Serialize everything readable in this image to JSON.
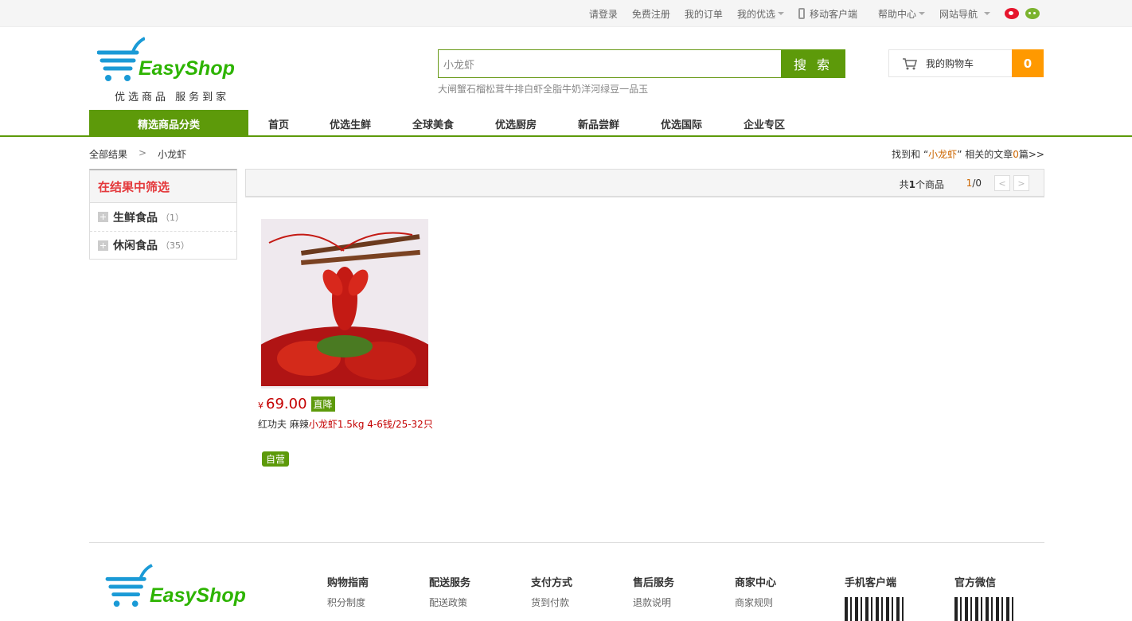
{
  "topbar": {
    "login": "请登录",
    "register": "免费注册",
    "orders": "我的订单",
    "my_youxuan": "我的优选",
    "mobile": "移动客户端",
    "help": "帮助中心",
    "site_nav": "网站导航"
  },
  "header": {
    "logo_text": "EasyShop",
    "slogan": "优选商品  服务到家",
    "search_value": "小龙虾",
    "search_button": "搜 索",
    "hot_words": [
      "大闸蟹",
      "石榴",
      "松茸",
      "牛排",
      "白虾",
      "全脂牛奶",
      "洋河",
      "绿豆",
      "一品玉"
    ],
    "cart_label": "我的购物车",
    "cart_count": "0"
  },
  "nav": {
    "category": "精选商品分类",
    "items": [
      "首页",
      "优选生鲜",
      "全球美食",
      "优选厨房",
      "新品尝鲜",
      "优选国际",
      "企业专区"
    ]
  },
  "breadcrumb": {
    "root": "全部结果",
    "sep": ">",
    "current": "小龙虾"
  },
  "found": {
    "prefix": "找到和 “",
    "keyword": "小龙虾",
    "suffix": "” 相关的文章",
    "count": "0",
    "unit": "篇>>"
  },
  "filter": {
    "title": "在结果中筛选",
    "items": [
      {
        "label": "生鲜食品",
        "count": "（1）"
      },
      {
        "label": "休闲食品",
        "count": "（35）"
      }
    ]
  },
  "results": {
    "total_prefix": "共",
    "total": "1",
    "total_suffix": "个商品",
    "page_current": "1",
    "page_sep": "/",
    "page_total": "0",
    "prev": "<",
    "next": ">"
  },
  "product": {
    "currency": "¥",
    "price": "69.00",
    "price_tag": "直降",
    "name_pre": "红功夫 麻辣",
    "name_hl": "小龙虾",
    "name_post": "1.5kg 4-6钱/25-32只",
    "self_tag": "自营"
  },
  "footer": {
    "logo_text": "EasyShop",
    "cols": [
      {
        "title": "购物指南",
        "first": "积分制度"
      },
      {
        "title": "配送服务",
        "first": "配送政策"
      },
      {
        "title": "支付方式",
        "first": "货到付款"
      },
      {
        "title": "售后服务",
        "first": "退款说明"
      },
      {
        "title": "商家中心",
        "first": "商家规则"
      }
    ],
    "app": "手机客户端",
    "wechat": "官方微信"
  },
  "colors": {
    "brand_green": "#5d9a0a",
    "logo_green": "#2db400",
    "logo_blue": "#1a9ad6",
    "cart_orange": "#ff9900",
    "price_red": "#c40000"
  }
}
